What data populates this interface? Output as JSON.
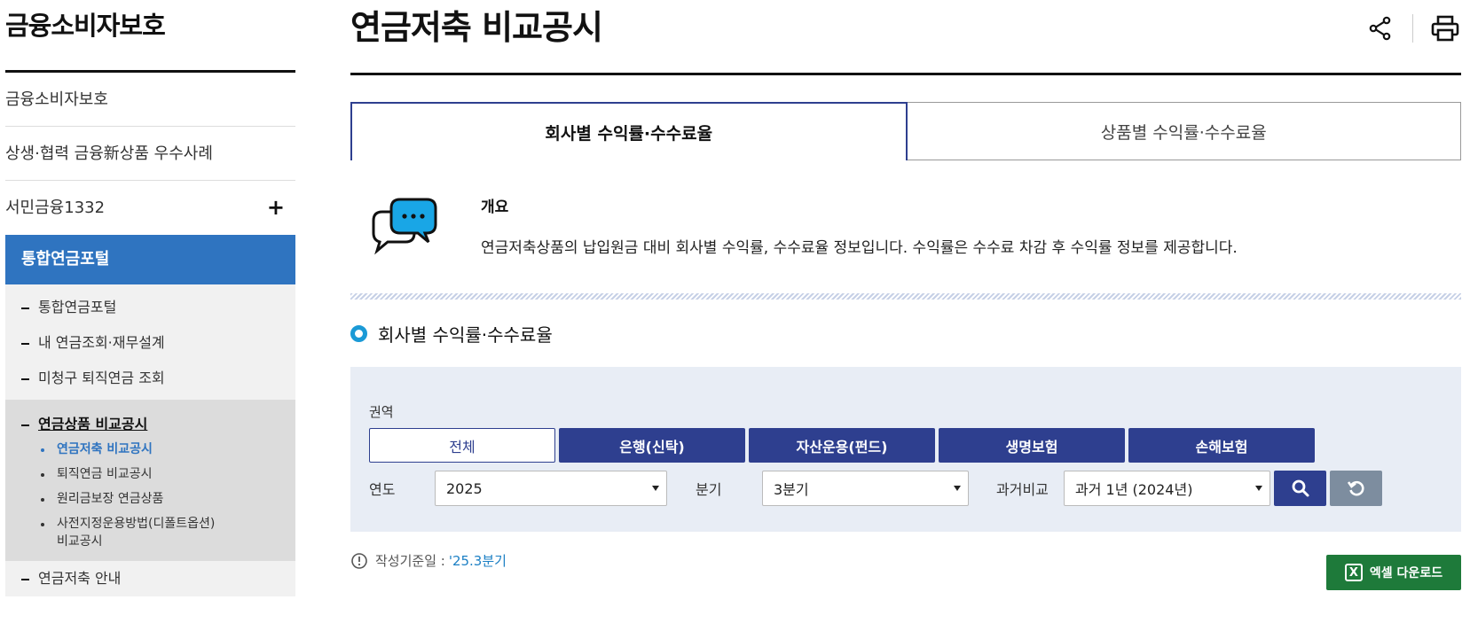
{
  "sidebar": {
    "title": "금융소비자보호",
    "items": [
      "금융소비자보호",
      "상생·협력 금융新상품 우수사례",
      "서민금융1332"
    ],
    "expand_symbol": "+",
    "active": "통합연금포털",
    "sub_items": [
      "통합연금포털",
      "내 연금조회·재무설계",
      "미청구 퇴직연금 조회"
    ],
    "current_group": "연금상품 비교공시",
    "leaves": [
      "연금저축 비교공시",
      "퇴직연금 비교공시",
      "원리금보장 연금상품",
      "사전지정운용방법(디폴트옵션)",
      "비교공시"
    ],
    "last_item": "연금저축 안내"
  },
  "header": {
    "title": "연금저축 비교공시",
    "share_icon": "share-icon",
    "print_icon": "print-icon"
  },
  "tabs": [
    {
      "label": "회사별 수익률·수수료율"
    },
    {
      "label": "상품별 수익률·수수료율"
    }
  ],
  "overview": {
    "title": "개요",
    "text": "연금저축상품의 납입원금 대비 회사별 수익률, 수수료율 정보입니다. 수익률은 수수료 차감 후 수익률 정보를 제공합니다."
  },
  "section": {
    "title": "회사별 수익률·수수료율"
  },
  "filter": {
    "region_label": "권역",
    "chips": [
      "전체",
      "은행(신탁)",
      "자산운용(펀드)",
      "생명보험",
      "손해보험"
    ],
    "year_label": "연도",
    "year_value": "2025",
    "quarter_label": "분기",
    "quarter_value": "3분기",
    "compare_label": "과거비교",
    "compare_value": "과거 1년 (2024년)"
  },
  "footer": {
    "basis_label": "작성기준일 :",
    "basis_value": "'25.3분기",
    "excel_label": "엑셀 다운로드",
    "excel_glyph": "X"
  },
  "colors": {
    "primary": "#2e3f8f",
    "sidebar_active": "#2f74c0",
    "accent": "#1b9ad6",
    "excel": "#1e7a3a",
    "reset": "#7d8d9f"
  }
}
